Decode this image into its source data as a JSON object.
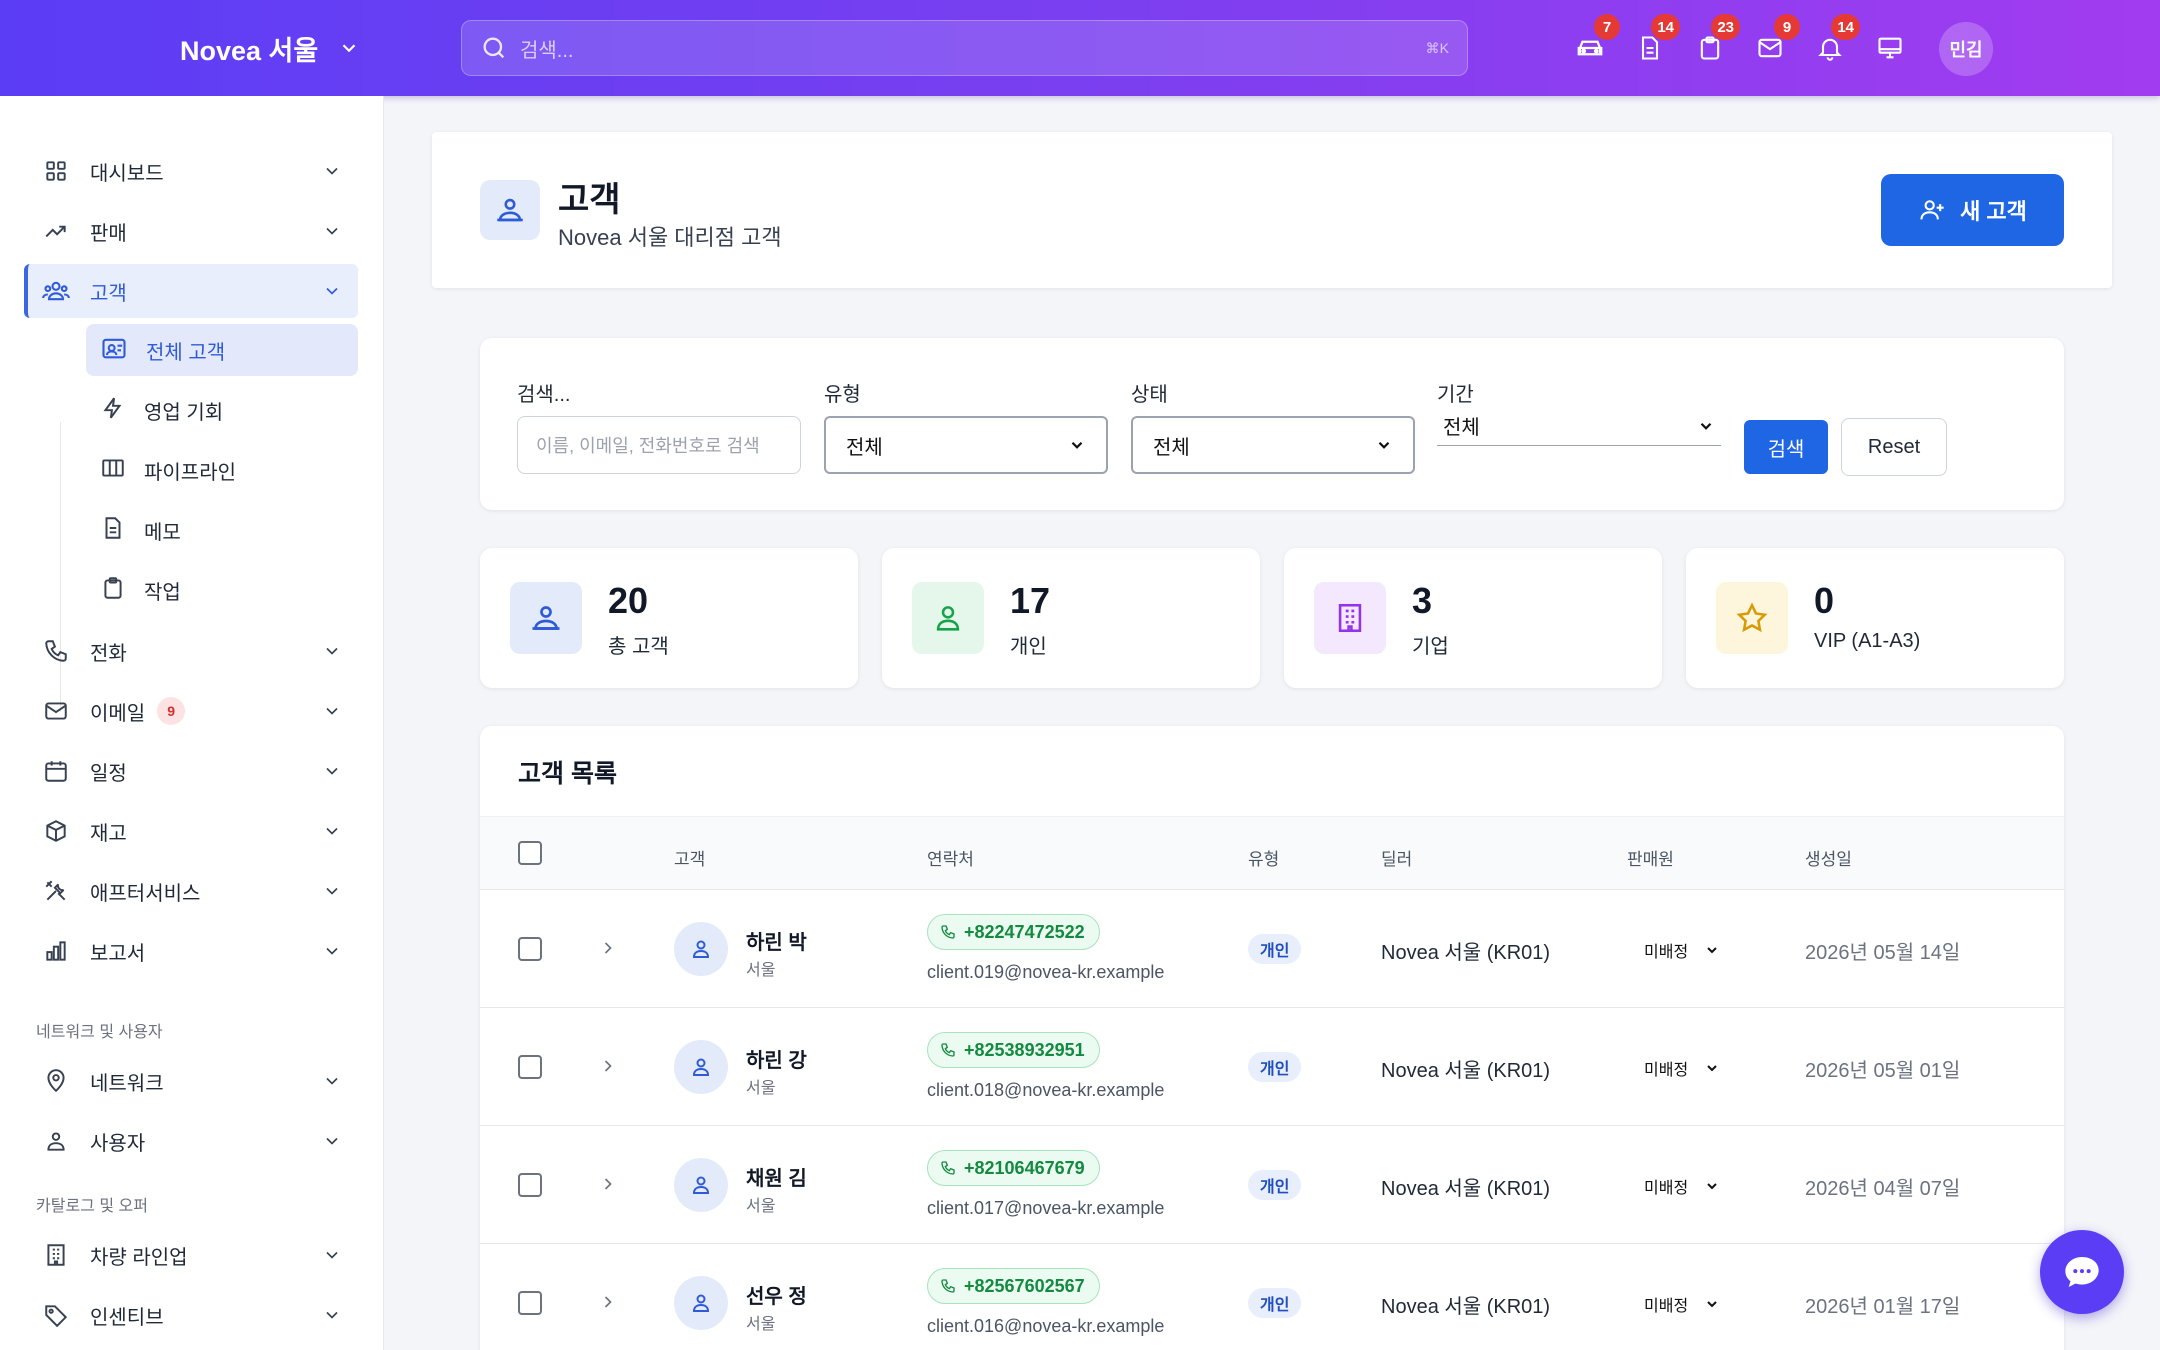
{
  "topbar": {
    "brand": "Novea 서울",
    "search_placeholder": "검색...",
    "search_shortcut": "⌘K",
    "icons": [
      {
        "name": "car-icon",
        "badge": "7"
      },
      {
        "name": "document-icon",
        "badge": "14"
      },
      {
        "name": "clipboard-icon",
        "badge": "23"
      },
      {
        "name": "mail-icon",
        "badge": "9"
      },
      {
        "name": "bell-icon",
        "badge": "14"
      },
      {
        "name": "monitor-icon",
        "badge": ""
      }
    ],
    "avatar": "민김"
  },
  "sidebar": {
    "items": [
      {
        "label": "대시보드",
        "icon": "grid-icon"
      },
      {
        "label": "판매",
        "icon": "trend-icon"
      },
      {
        "label": "고객",
        "icon": "users-icon"
      },
      {
        "label": "전화",
        "icon": "phone-icon"
      },
      {
        "label": "이메일",
        "icon": "mail-icon",
        "badge": "9"
      },
      {
        "label": "일정",
        "icon": "calendar-icon"
      },
      {
        "label": "재고",
        "icon": "box-icon"
      },
      {
        "label": "애프터서비스",
        "icon": "tools-icon"
      },
      {
        "label": "보고서",
        "icon": "chart-icon"
      }
    ],
    "sub_items": [
      {
        "label": "전체 고객",
        "icon": "contact-card-icon"
      },
      {
        "label": "영업 기회",
        "icon": "bolt-icon"
      },
      {
        "label": "파이프라인",
        "icon": "columns-icon"
      },
      {
        "label": "메모",
        "icon": "note-icon"
      },
      {
        "label": "작업",
        "icon": "clipboard-icon"
      }
    ],
    "section_network": "네트워크 및 사용자",
    "network_items": [
      {
        "label": "네트워크",
        "icon": "location-icon"
      },
      {
        "label": "사용자",
        "icon": "user-group-icon"
      }
    ],
    "section_catalog": "카탈로그 및 오퍼",
    "catalog_items": [
      {
        "label": "차량 라인업",
        "icon": "building-icon"
      },
      {
        "label": "인센티브",
        "icon": "tag-icon"
      }
    ]
  },
  "header": {
    "title": "고객",
    "subtitle": "Novea 서울 대리점 고객",
    "new_button": "새 고객"
  },
  "filters": {
    "search_label": "검색...",
    "search_placeholder": "이름, 이메일, 전화번호로 검색",
    "type_label": "유형",
    "type_value": "전체",
    "status_label": "상태",
    "status_value": "전체",
    "period_label": "기간",
    "period_value": "전체",
    "search_button": "검색",
    "reset_button": "Reset"
  },
  "stats": [
    {
      "value": "20",
      "label": "총 고객",
      "color": "#2f5bd8",
      "bg": "#e3ebfb"
    },
    {
      "value": "17",
      "label": "개인",
      "color": "#16a34a",
      "bg": "#e4f7ea"
    },
    {
      "value": "3",
      "label": "기업",
      "color": "#9333ea",
      "bg": "#f3e8fd"
    },
    {
      "value": "0",
      "label": "VIP (A1-A3)",
      "color": "#d99a06",
      "bg": "#fdf6dc"
    }
  ],
  "table": {
    "title": "고객 목록",
    "columns": [
      "고객",
      "연락처",
      "유형",
      "딜러",
      "판매원",
      "생성일"
    ],
    "rows": [
      {
        "name": "하린 박",
        "city": "서울",
        "phone": "+82247472522",
        "email": "client.019@novea-kr.example",
        "type": "개인",
        "dealer": "Novea 서울 (KR01)",
        "seller": "미배정",
        "date": "2026년 05월 14일"
      },
      {
        "name": "하린 강",
        "city": "서울",
        "phone": "+82538932951",
        "email": "client.018@novea-kr.example",
        "type": "개인",
        "dealer": "Novea 서울 (KR01)",
        "seller": "미배정",
        "date": "2026년 05월 01일"
      },
      {
        "name": "채원 김",
        "city": "서울",
        "phone": "+82106467679",
        "email": "client.017@novea-kr.example",
        "type": "개인",
        "dealer": "Novea 서울 (KR01)",
        "seller": "미배정",
        "date": "2026년 04월 07일"
      },
      {
        "name": "선우 정",
        "city": "서울",
        "phone": "+82567602567",
        "email": "client.016@novea-kr.example",
        "type": "개인",
        "dealer": "Novea 서울 (KR01)",
        "seller": "미배정",
        "date": "2026년 01월 17일"
      }
    ]
  }
}
